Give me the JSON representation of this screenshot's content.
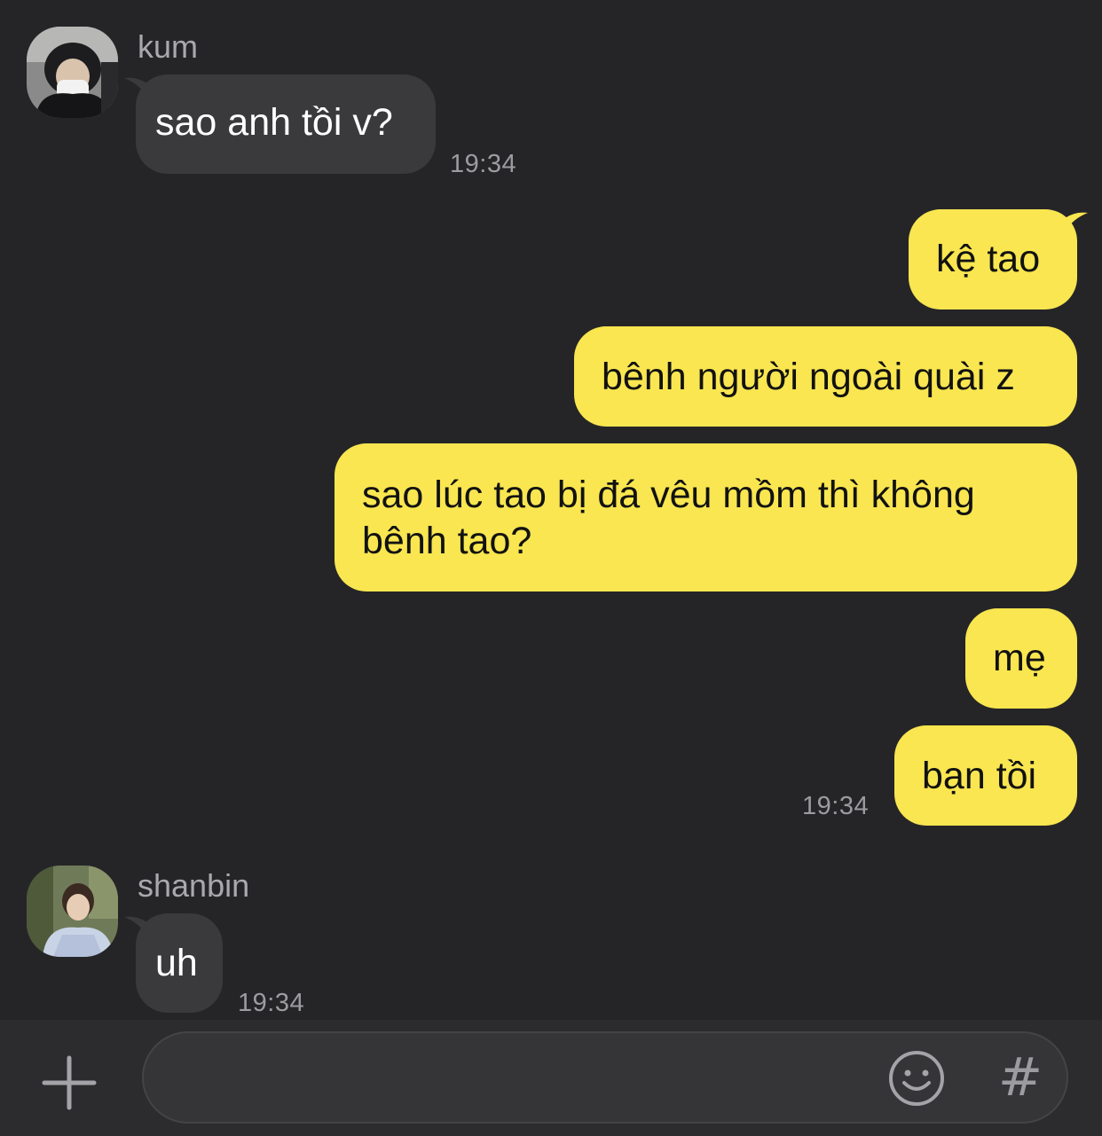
{
  "chat": {
    "incoming_1": {
      "sender": "kum",
      "message": "sao anh tồi v?",
      "time": "19:34"
    },
    "outgoing": {
      "messages": [
        "kệ tao",
        "bênh người ngoài quài z",
        "sao lúc tao bị đá vêu mồm thì không",
        "bênh tao?",
        "mẹ",
        "bạn tồi"
      ],
      "time": "19:34"
    },
    "incoming_2": {
      "sender": "shanbin",
      "message": "uh",
      "time": "19:34"
    }
  },
  "input_bar": {
    "placeholder": "",
    "value": "",
    "hash_label": "#"
  },
  "icons": {
    "plus": "plus-icon",
    "emoji": "smiley-icon",
    "hash": "hash-icon"
  },
  "colors": {
    "background": "#252527",
    "incoming_bubble": "#3a3a3d",
    "outgoing_bubble": "#f9e650"
  }
}
